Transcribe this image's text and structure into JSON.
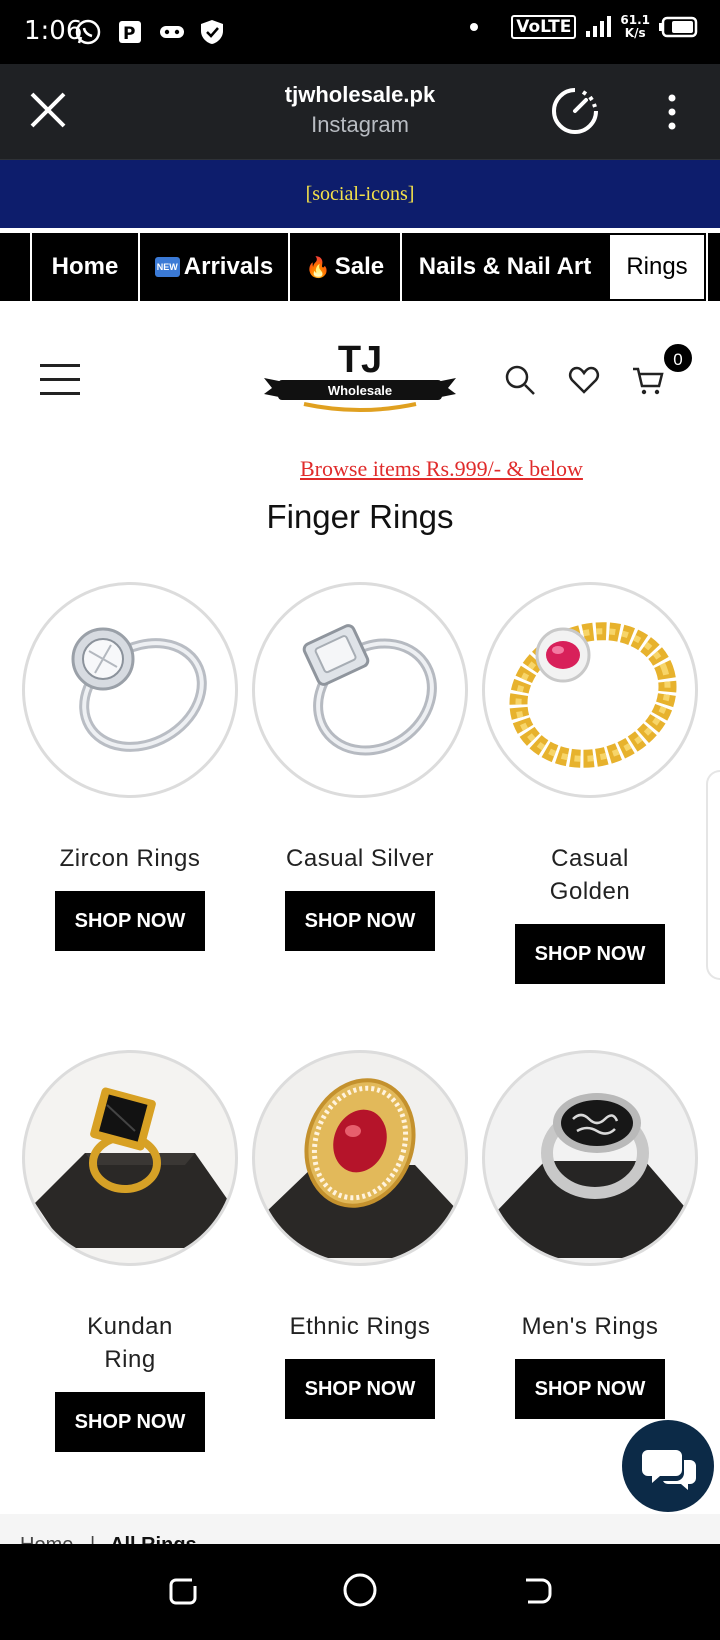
{
  "status_bar": {
    "time": "1:06",
    "network": "VoLTE",
    "speed_value": "61.1",
    "speed_unit": "K/s",
    "icons": [
      "whatsapp-icon",
      "parking-icon",
      "gamepad-icon",
      "shield-icon",
      "dot-icon",
      "signal-icon",
      "battery-icon"
    ]
  },
  "browser": {
    "domain": "tjwholesale.pk",
    "source": "Instagram",
    "icons": [
      "close-icon",
      "speedometer-icon",
      "kebab-menu-icon"
    ]
  },
  "announcement": "[social-icons]",
  "nav_tabs": [
    {
      "label": "Home",
      "badge": ""
    },
    {
      "label": "Arrivals",
      "badge": "NEW"
    },
    {
      "label": "Sale",
      "badge": "🔥"
    },
    {
      "label": "Nails & Nail Art",
      "badge": ""
    },
    {
      "label": "Rings",
      "badge": ""
    }
  ],
  "header": {
    "logo_top": "TJ",
    "logo_banner": "Wholesale",
    "cart_count": "0",
    "icons": [
      "hamburger-icon",
      "search-icon",
      "heart-icon",
      "cart-icon"
    ]
  },
  "browse_link": "Browse items Rs.999/- & below",
  "page_title": "Finger Rings",
  "categories": [
    {
      "title": "Zircon Rings",
      "button": "SHOP NOW"
    },
    {
      "title": "Casual Silver",
      "button": "SHOP NOW"
    },
    {
      "title": "Casual Golden",
      "button": "SHOP NOW"
    },
    {
      "title": "Kundan Ring",
      "button": "SHOP NOW"
    },
    {
      "title": "Ethnic Rings",
      "button": "SHOP NOW"
    },
    {
      "title": "Men's Rings",
      "button": "SHOP NOW"
    }
  ],
  "breadcrumb": {
    "home": "Home",
    "separator": "|",
    "current": "All Rings"
  },
  "colors": {
    "announcement_bg": "#0d1d6c",
    "announcement_text": "#f3e14a",
    "browse_link": "#e02b2b",
    "chat_button": "#0c2a47"
  }
}
